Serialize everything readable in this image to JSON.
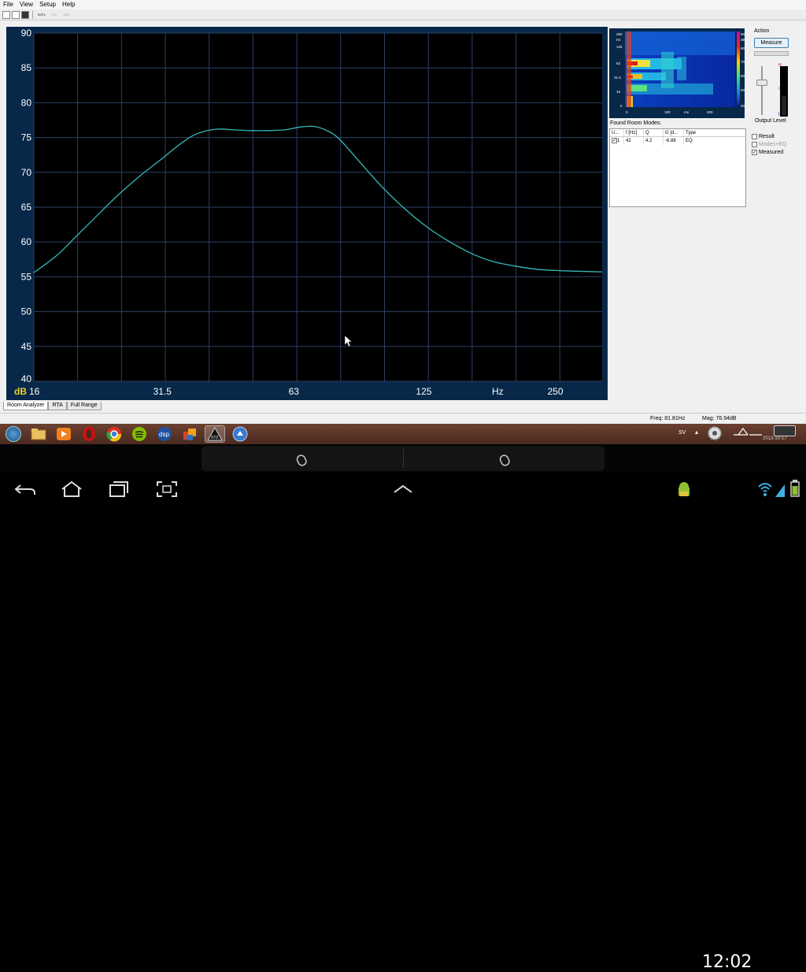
{
  "menu": [
    "File",
    "View",
    "Setup",
    "Help"
  ],
  "toolbar": {
    "btn1": "SCFL",
    "btn2": "STL",
    "btn3": "DEL"
  },
  "colors": {
    "plot_bg": "#000000",
    "plot_frame": "#072848",
    "grid": "#2e3f66",
    "curve": "#35b8b8",
    "axis_text": "#ffffff",
    "db_label": "#f0d030"
  },
  "chart_data": {
    "type": "line",
    "xscale": "log",
    "xlim": [
      16,
      320
    ],
    "ylim": [
      40,
      90
    ],
    "yticks": [
      40,
      45,
      50,
      55,
      60,
      65,
      70,
      75,
      80,
      85,
      90
    ],
    "xticks": [
      16,
      31.5,
      63,
      125,
      250
    ],
    "xticklabels": [
      "16",
      "31.5",
      "63",
      "125",
      "250"
    ],
    "ylabel": "dB",
    "xlabel": "Hz",
    "grid": true,
    "series": [
      {
        "x": [
          16,
          18,
          20,
          22.5,
          25,
          28,
          31.5,
          35,
          38,
          42,
          46,
          50,
          55,
          60,
          65,
          70,
          75,
          80,
          90,
          100,
          112,
          125,
          140,
          160,
          180,
          200,
          225,
          250,
          280,
          320
        ],
        "y": [
          55.6,
          58.0,
          60.8,
          64.0,
          66.8,
          69.5,
          72.0,
          74.3,
          75.6,
          76.2,
          76.1,
          76.0,
          76.0,
          76.1,
          76.5,
          76.6,
          76.0,
          74.8,
          71.2,
          68.0,
          65.0,
          62.5,
          60.4,
          58.4,
          57.2,
          56.6,
          56.1,
          55.9,
          55.8,
          55.7
        ]
      }
    ]
  },
  "waterfall": {
    "yticks": [
      "250",
      "Hz",
      "125",
      "63",
      "31.5",
      "16",
      "0"
    ],
    "xticks": [
      "0",
      "100",
      "ms",
      "200"
    ],
    "scale": [
      "90",
      "dB",
      "80",
      "70",
      "60",
      "50",
      "40"
    ]
  },
  "modes": {
    "label": "Found Room Modes:",
    "headers": [
      "U...",
      "f [Hz]",
      "Q",
      "G [d...",
      "Type"
    ],
    "rows": [
      {
        "u": "1",
        "f": "42",
        "q": "4.2",
        "g": "-6.88",
        "type": "EQ"
      }
    ]
  },
  "action": {
    "label": "Action",
    "measure": "Measure",
    "output": "Output Level",
    "meter_h": "H",
    "meter_g": "G",
    "meter_l": "L",
    "level": 0.4
  },
  "options": [
    {
      "label": "Result",
      "checked": false,
      "enabled": true
    },
    {
      "label": "Modes+EQ",
      "checked": false,
      "enabled": false
    },
    {
      "label": "Measured",
      "checked": true,
      "enabled": true
    }
  ],
  "tabs": [
    "Room Analyzer",
    "RTA",
    "Full Range"
  ],
  "status": {
    "freq": "Freq: 81.81Hz",
    "mag": "Mag: 76.94dB"
  },
  "tray": {
    "lang": "SV",
    "date": "2013-10-17"
  },
  "clock": "12:02"
}
